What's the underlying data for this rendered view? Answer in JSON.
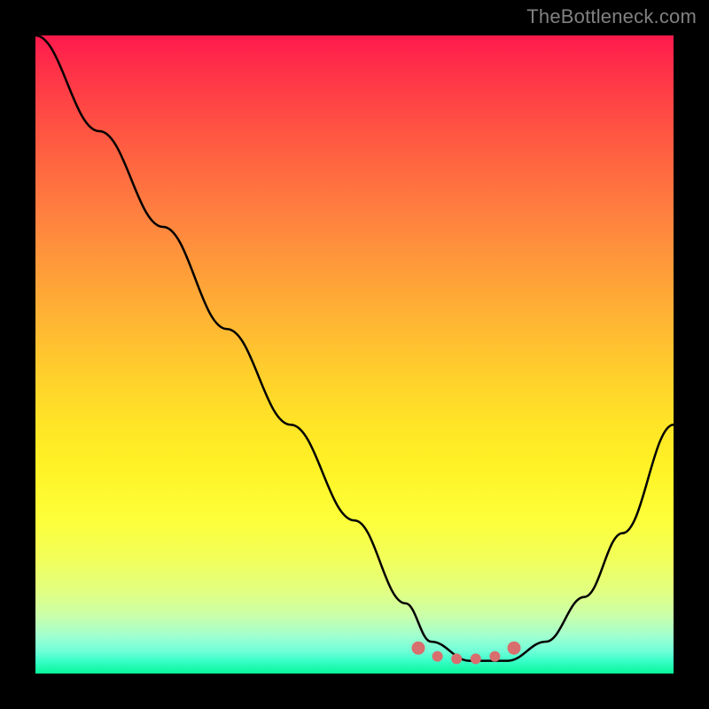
{
  "watermark": "TheBottleneck.com",
  "chart_data": {
    "type": "line",
    "title": "",
    "xlabel": "",
    "ylabel": "",
    "xlim": [
      0,
      100
    ],
    "ylim": [
      0,
      100
    ],
    "series": [
      {
        "name": "bottleneck-curve",
        "x": [
          0,
          10,
          20,
          30,
          40,
          50,
          58,
          62,
          68,
          74,
          80,
          86,
          92,
          100
        ],
        "y": [
          100,
          85,
          70,
          54,
          39,
          24,
          11,
          5,
          2,
          2,
          5,
          12,
          22,
          39
        ]
      }
    ],
    "annotations": [
      {
        "name": "optimal-range",
        "type": "dots",
        "x": [
          60,
          63,
          66,
          69,
          72,
          75
        ],
        "y": [
          4,
          2.7,
          2.3,
          2.3,
          2.7,
          4
        ],
        "color": "#d86e6e"
      }
    ],
    "gradient_stops": [
      {
        "pos": 0,
        "color": "#ff1a4d"
      },
      {
        "pos": 50,
        "color": "#ffcc2d"
      },
      {
        "pos": 80,
        "color": "#fdff3a"
      },
      {
        "pos": 100,
        "color": "#07f59a"
      }
    ]
  }
}
